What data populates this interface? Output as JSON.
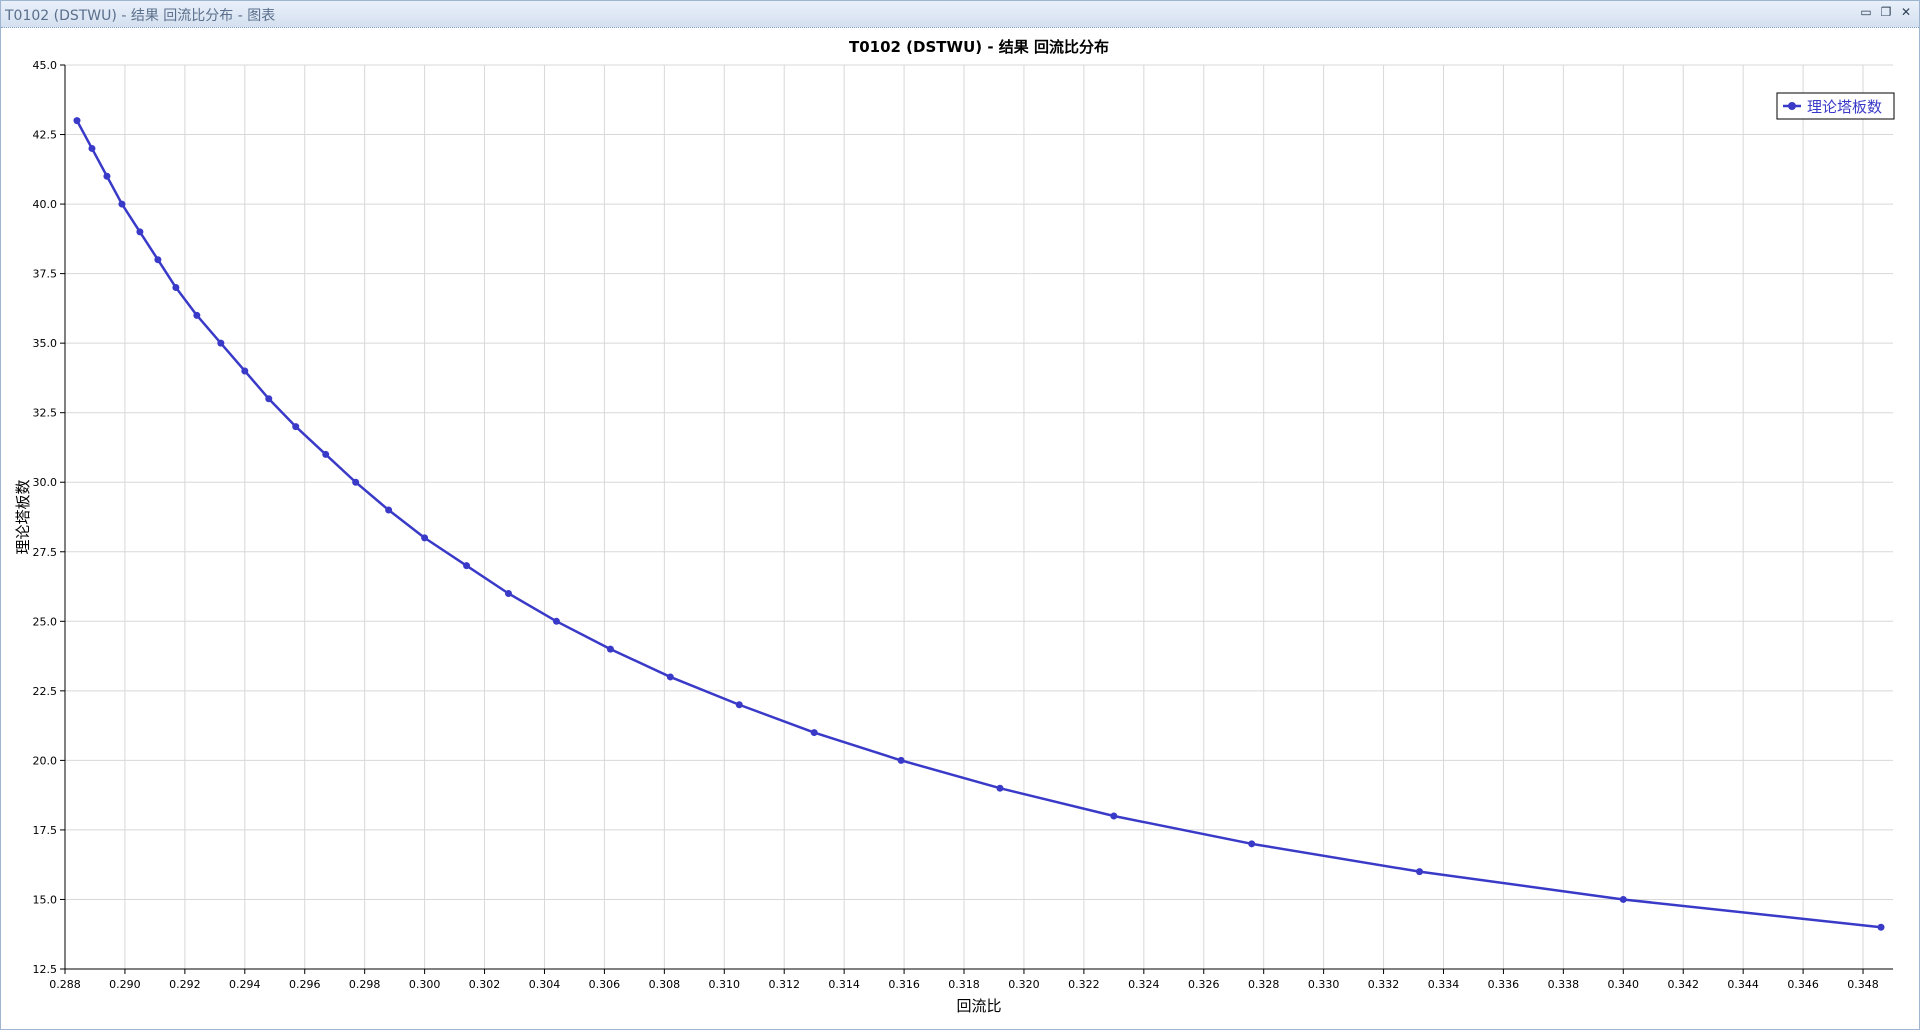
{
  "window": {
    "title": "T0102 (DSTWU) - 结果 回流比分布 - 图表",
    "buttons": {
      "minimize": "▭",
      "restore": "❐",
      "close": "✕"
    }
  },
  "chart_data": {
    "type": "line",
    "title": "T0102 (DSTWU) - 结果 回流比分布",
    "xlabel": "回流比",
    "ylabel": "理论塔板数",
    "xlim": [
      0.288,
      0.349
    ],
    "ylim": [
      12.5,
      45.0
    ],
    "x_ticks": [
      "0.288",
      "0.290",
      "0.292",
      "0.294",
      "0.296",
      "0.298",
      "0.300",
      "0.302",
      "0.304",
      "0.306",
      "0.308",
      "0.310",
      "0.312",
      "0.314",
      "0.316",
      "0.318",
      "0.320",
      "0.322",
      "0.324",
      "0.326",
      "0.328",
      "0.330",
      "0.332",
      "0.334",
      "0.336",
      "0.338",
      "0.340",
      "0.342",
      "0.344",
      "0.346",
      "0.348"
    ],
    "y_ticks": [
      "12.5",
      "15.0",
      "17.5",
      "20.0",
      "22.5",
      "25.0",
      "27.5",
      "30.0",
      "32.5",
      "35.0",
      "37.5",
      "40.0",
      "42.5",
      "45.0"
    ],
    "grid": true,
    "legend_position": "top-right",
    "series_color": "#3a3ac8",
    "series": [
      {
        "name": "理论塔板数",
        "x": [
          0.2884,
          0.2889,
          0.2894,
          0.2899,
          0.2905,
          0.2911,
          0.2917,
          0.2924,
          0.2932,
          0.294,
          0.2948,
          0.2957,
          0.2967,
          0.2977,
          0.2988,
          0.3,
          0.3014,
          0.3028,
          0.3044,
          0.3062,
          0.3082,
          0.3105,
          0.313,
          0.3159,
          0.3192,
          0.323,
          0.3276,
          0.3332,
          0.34,
          0.3486
        ],
        "y": [
          43,
          42,
          41,
          40,
          39,
          38,
          37,
          36,
          35,
          34,
          33,
          32,
          31,
          30,
          29,
          28,
          27,
          26,
          25,
          24,
          23,
          22,
          21,
          20,
          19,
          18,
          17,
          16,
          15,
          14
        ]
      }
    ]
  }
}
